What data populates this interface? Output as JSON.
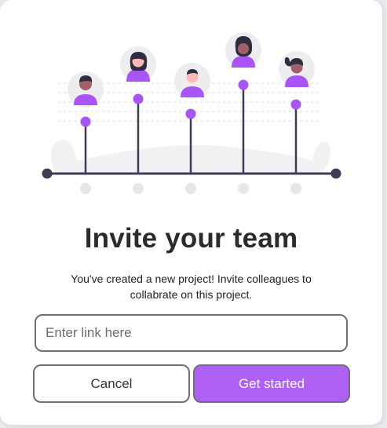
{
  "dialog": {
    "title": "Invite your team",
    "subtitle": "You've created a new project! Invite colleagues to collabrate on this project.",
    "link_input": {
      "value": "",
      "placeholder": "Enter link here"
    },
    "cancel_label": "Cancel",
    "primary_label": "Get started"
  },
  "colors": {
    "accent": "#b060f4",
    "avatar_purple": "#a855f7",
    "line_dark": "#3f3d56",
    "text_dark": "#2b2b2b"
  },
  "illustration": {
    "team_members": 5,
    "icon": "team-people-illustration"
  }
}
